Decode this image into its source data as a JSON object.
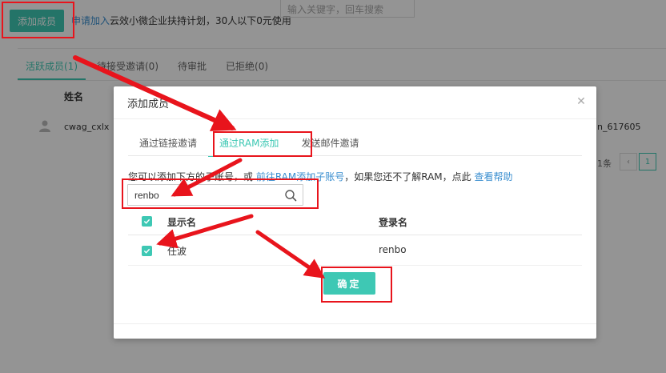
{
  "background": {
    "add_member_button": "添加成员",
    "apply_link": "申请加入",
    "apply_text": "云效小微企业扶持计划，30人以下0元使用",
    "search_placeholder": "输入关键字，回车搜索",
    "tabs": [
      {
        "label": "活跃成员(1)",
        "active": true
      },
      {
        "label": "待接受邀请(0)",
        "active": false
      },
      {
        "label": "待审批",
        "active": false
      },
      {
        "label": "已拒绝(0)",
        "active": false
      }
    ],
    "column_name": "姓名",
    "user_name": "cwag_cxlx",
    "right_id": "n_617605",
    "right_count": "1条",
    "pager_current": "1"
  },
  "dialog": {
    "title": "添加成员",
    "close_icon": "close-icon",
    "tabs": [
      {
        "label": "通过链接邀请",
        "active": false
      },
      {
        "label": "通过RAM添加",
        "active": true
      },
      {
        "label": "发送邮件邀请",
        "active": false
      }
    ],
    "info_text_1": "您可以添加下方的子账号，或 ",
    "info_link_1": "前往RAM添加子账号",
    "info_text_2": "，如果您还不了解RAM，点此 ",
    "info_link_2": "查看帮助",
    "search_value": "renbo",
    "table": {
      "header_display": "显示名",
      "header_login": "登录名",
      "rows": [
        {
          "display_name": "任波",
          "login_name": "renbo",
          "checked": true
        }
      ]
    },
    "confirm_button": "确定"
  },
  "colors": {
    "accent": "#3ec8b4",
    "link": "#3b8fd0",
    "annotation": "#e8141c"
  }
}
